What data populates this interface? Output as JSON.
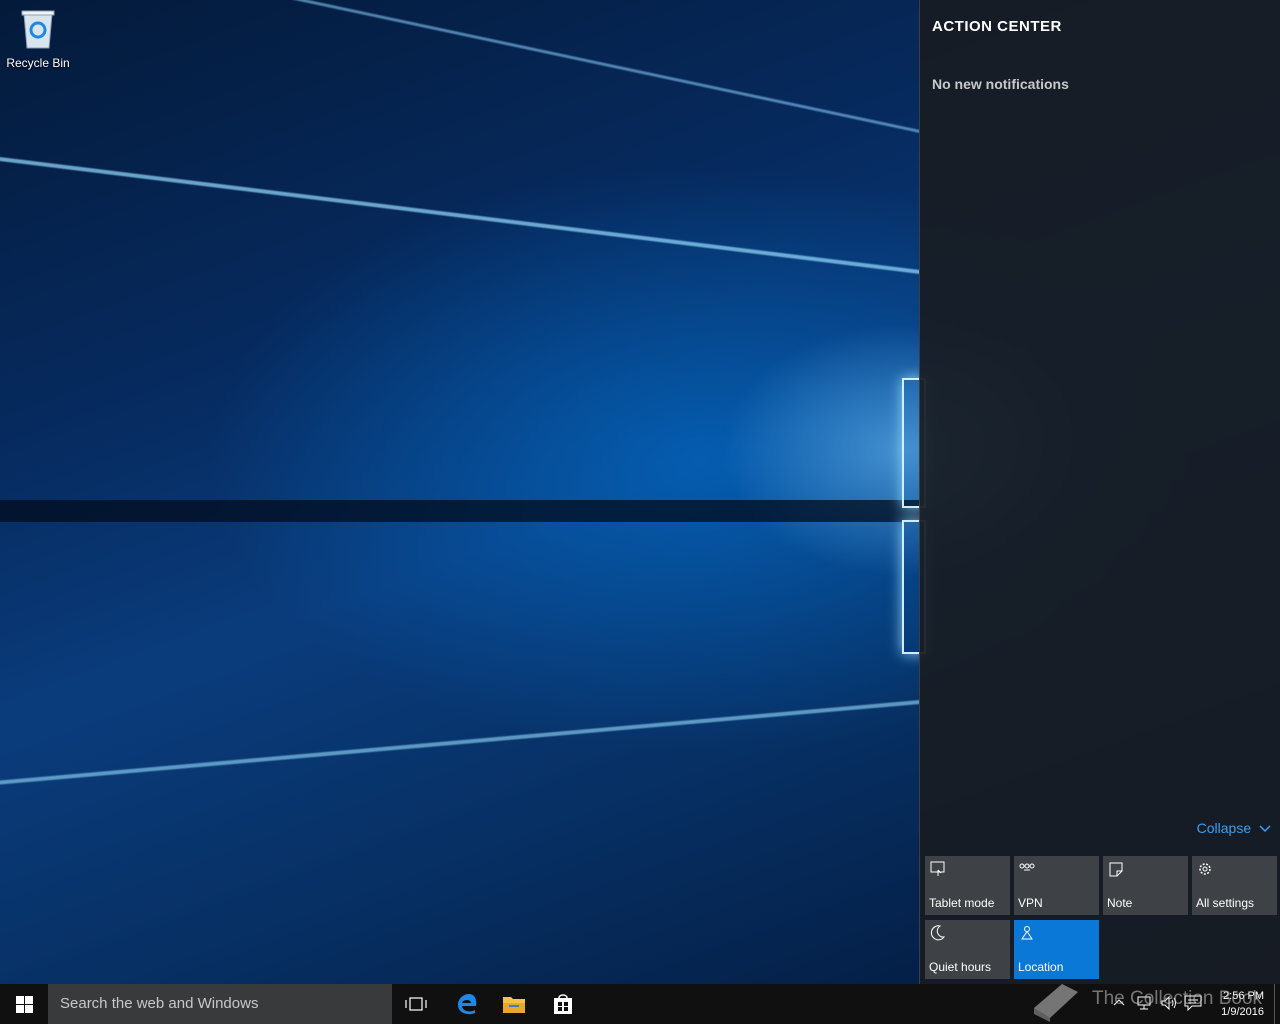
{
  "desktop": {
    "icons": [
      {
        "label": "Recycle Bin",
        "icon": "recycle-bin-icon"
      }
    ]
  },
  "action_center": {
    "title": "ACTION CENTER",
    "empty_message": "No new notifications",
    "collapse_label": "Collapse",
    "quick_actions": [
      {
        "label": "Tablet mode",
        "icon": "tablet-mode-icon",
        "active": false
      },
      {
        "label": "VPN",
        "icon": "vpn-icon",
        "active": false
      },
      {
        "label": "Note",
        "icon": "note-icon",
        "active": false
      },
      {
        "label": "All settings",
        "icon": "gear-icon",
        "active": false
      },
      {
        "label": "Quiet hours",
        "icon": "moon-icon",
        "active": false
      },
      {
        "label": "Location",
        "icon": "location-icon",
        "active": true
      }
    ],
    "accent_color": "#0a78d7"
  },
  "taskbar": {
    "search_placeholder": "Search the web and Windows",
    "pinned": [
      {
        "name": "task-view",
        "icon": "task-view-icon"
      },
      {
        "name": "edge",
        "icon": "edge-icon"
      },
      {
        "name": "file-explorer",
        "icon": "folder-icon"
      },
      {
        "name": "store",
        "icon": "store-icon"
      }
    ],
    "clock": {
      "time": "2:56 PM",
      "date": "1/9/2016"
    }
  },
  "watermark": {
    "text": "The Collection Book"
  }
}
